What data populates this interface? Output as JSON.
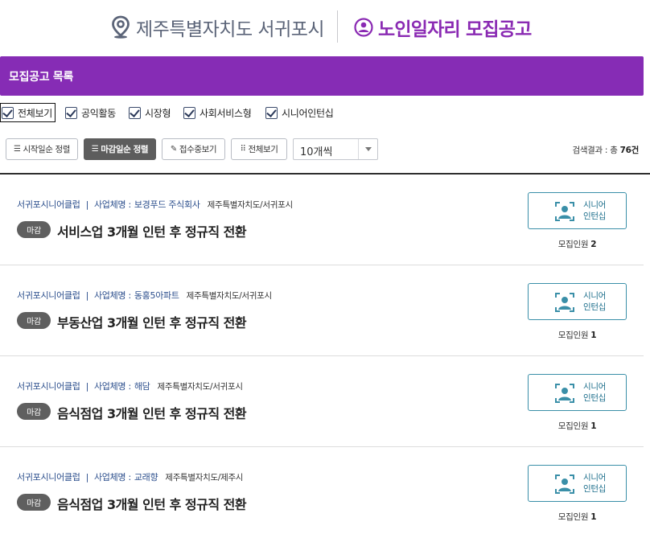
{
  "header": {
    "region_text": "제주특별자치도 서귀포시",
    "title_text": "노인일자리 모집공고"
  },
  "section": {
    "title": "모집공고 목록"
  },
  "filters": [
    {
      "label": "전체보기",
      "checked": true
    },
    {
      "label": "공익활동",
      "checked": true
    },
    {
      "label": "시장형",
      "checked": true
    },
    {
      "label": "사회서비스형",
      "checked": true
    },
    {
      "label": "시니어인턴십",
      "checked": true
    }
  ],
  "toolbar": {
    "sort_start": "시작일순 정렬",
    "sort_end": "마감일순 정렬",
    "receiving": "접수중보기",
    "view_all": "전체보기",
    "page_size": "10개씩",
    "result_label": "검색결과 : 총",
    "result_count": "76건"
  },
  "items": [
    {
      "org": "서귀포시니어클럽",
      "sep": "|",
      "company_label": "사업체명 :",
      "company": "보경푸드 주식회사",
      "region": "제주특별자치도/서귀포시",
      "status": "마감",
      "title": "서비스업 3개월 인턴 후 정규직 전환",
      "type_line1": "시니어",
      "type_line2": "인턴십",
      "count_label": "모집인원",
      "count": "2"
    },
    {
      "org": "서귀포시니어클럽",
      "sep": "|",
      "company_label": "사업체명 :",
      "company": "동홍5아파트",
      "region": "제주특별자치도/서귀포시",
      "status": "마감",
      "title": "부동산업 3개월 인턴 후 정규직 전환",
      "type_line1": "시니어",
      "type_line2": "인턴십",
      "count_label": "모집인원",
      "count": "1"
    },
    {
      "org": "서귀포시니어클럽",
      "sep": "|",
      "company_label": "사업체명 :",
      "company": "해담",
      "region": "제주특별자치도/서귀포시",
      "status": "마감",
      "title": "음식점업 3개월 인턴 후 정규직 전환",
      "type_line1": "시니어",
      "type_line2": "인턴십",
      "count_label": "모집인원",
      "count": "1"
    },
    {
      "org": "서귀포시니어클럽",
      "sep": "|",
      "company_label": "사업체명 :",
      "company": "교래향",
      "region": "제주특별자치도/제주시",
      "status": "마감",
      "title": "음식점업 3개월 인턴 후 정규직 전환",
      "type_line1": "시니어",
      "type_line2": "인턴십",
      "count_label": "모집인원",
      "count": "1"
    }
  ],
  "colors": {
    "accent_purple": "#862cb5",
    "region_gray": "#5b6478",
    "link_blue": "#2b4e8c",
    "teal": "#3a8fa8"
  },
  "icons": {
    "region": "location-pin-icon",
    "title": "person-circle-icon",
    "type": "person-frame-icon"
  }
}
